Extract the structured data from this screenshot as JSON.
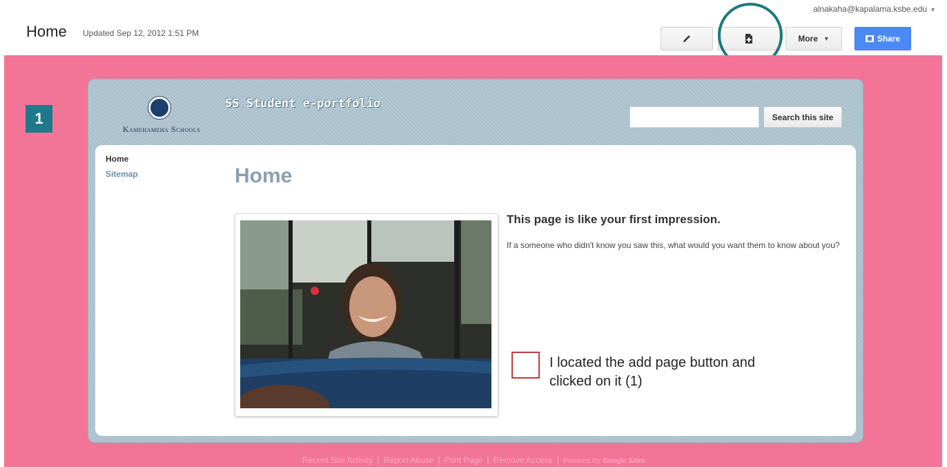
{
  "header": {
    "title": "Home",
    "updated": "Updated Sep 12, 2012 1:51 PM",
    "account": "alnakaha@kapalama.ksbe.edu",
    "more_label": "More",
    "share_label": "Share"
  },
  "annotation": {
    "step_number": "1",
    "checklist_text": "I located the add page button and clicked on it (1)"
  },
  "site": {
    "school_name": "Kamehameha Schools",
    "title": "SS Student e-portfolio",
    "search_button": "Search this site",
    "search_placeholder": "",
    "nav": [
      "Home",
      "Sitemap"
    ],
    "page_heading": "Home",
    "impression": "This page is like your first impression.",
    "prompt": "If a someone who didn't know you saw this, what would you want them to know about you?"
  },
  "footer": {
    "links": [
      "Recent Site Activity",
      "Report Abuse",
      "Print Page",
      "Remove Access"
    ],
    "powered_by": "Powered By",
    "powered_brand": "Google Sites"
  },
  "colors": {
    "background": "#f27598",
    "share_button": "#4a8af4",
    "annotation_circle": "#1a7a7e",
    "step_badge": "#1e7a8a",
    "checkbox_border": "#c23a3a"
  },
  "icons": [
    "pencil-icon",
    "new-page-icon",
    "share-icon",
    "chevron-down-icon"
  ]
}
